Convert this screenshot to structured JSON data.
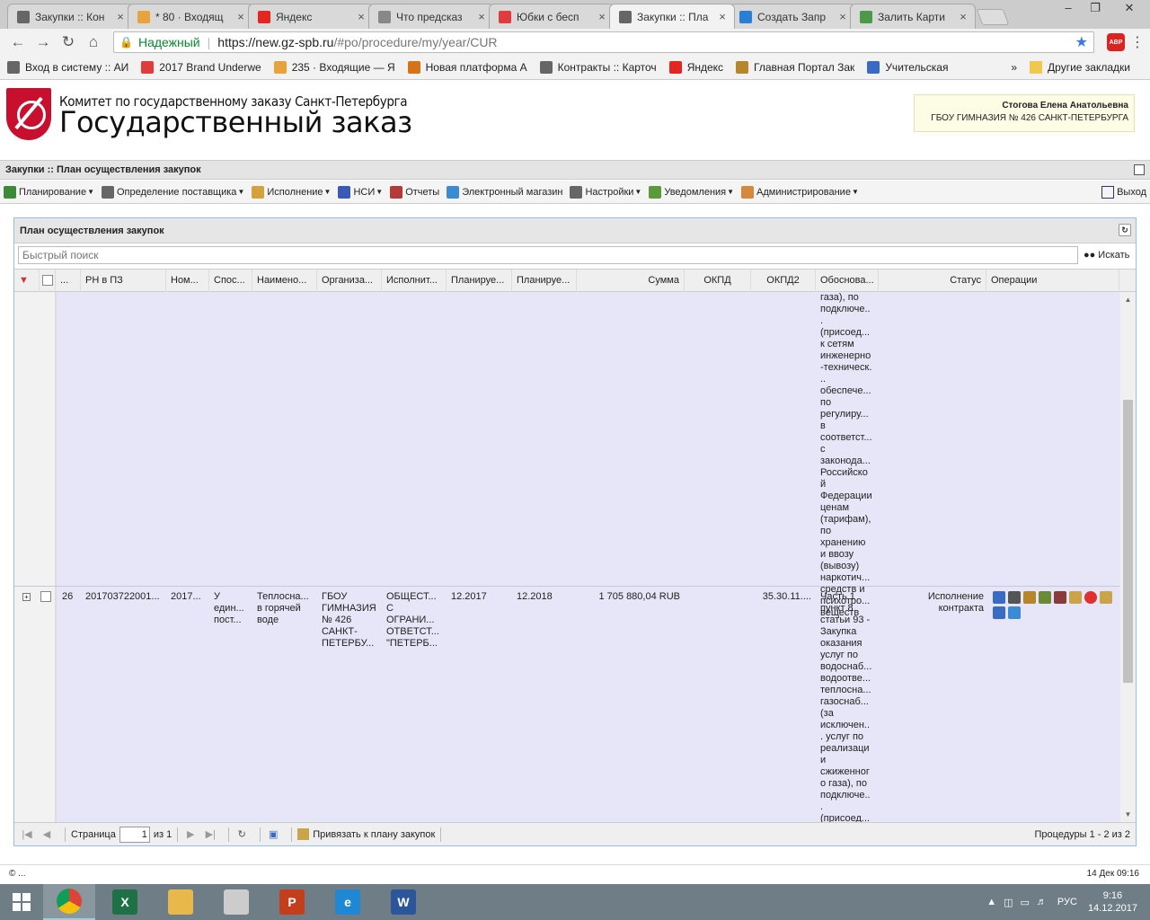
{
  "browser": {
    "tabs": [
      {
        "label": "Закупки :: Кон",
        "icon": "hammer-icon",
        "color": "#666666",
        "active": false
      },
      {
        "label": "* 80 · Входящ",
        "icon": "mail-icon",
        "color": "#e8a33d",
        "active": false
      },
      {
        "label": "Яндекс",
        "icon": "yandex-icon",
        "color": "#e52620",
        "active": false
      },
      {
        "label": "Что предсказ",
        "icon": "page-icon",
        "color": "#888888",
        "active": false
      },
      {
        "label": "Юбки с бесп",
        "icon": "pocket-icon",
        "color": "#e03c3c",
        "active": false
      },
      {
        "label": "Закупки :: Пла",
        "icon": "hammer-icon",
        "color": "#666666",
        "active": true
      },
      {
        "label": "Создать Запр",
        "icon": "globe-icon",
        "color": "#2a7fd4",
        "active": false
      },
      {
        "label": "Залить Карти",
        "icon": "image-icon",
        "color": "#4a9a4a",
        "active": false
      }
    ],
    "url_secure_label": "Надежный",
    "url_host": "https://new.gz-spb.ru",
    "url_path": "/#po/procedure/my/year/CUR",
    "abp_label": "ABP",
    "bookmarks": [
      {
        "label": "Вход в систему :: АИ",
        "icon": "hammer-icon",
        "color": "#666666"
      },
      {
        "label": "2017 Brand Underwe",
        "icon": "pocket-icon",
        "color": "#e03c3c"
      },
      {
        "label": "235 · Входящие — Я",
        "icon": "mail-icon",
        "color": "#e8a33d"
      },
      {
        "label": "Новая платформа А",
        "icon": "m-icon",
        "color": "#d4731a"
      },
      {
        "label": "Контракты :: Карточ",
        "icon": "hammer-icon",
        "color": "#666666"
      },
      {
        "label": "Яндекс",
        "icon": "yandex-icon",
        "color": "#e52620"
      },
      {
        "label": "Главная Портал Зак",
        "icon": "eagle-icon",
        "color": "#b8862a"
      },
      {
        "label": "Учительская",
        "icon": "square-icon",
        "color": "#3a6bc4"
      }
    ],
    "bookmarks_more": "»",
    "other_bookmarks": "Другие закладки"
  },
  "site": {
    "subtitle": "Комитет по государственному заказу Санкт-Петербурга",
    "title": "Государственный заказ",
    "user_name": "Стогова Елена Анатольевна",
    "user_org": "ГБОУ ГИМНАЗИЯ № 426 САНКТ-ПЕТЕРБУРГА"
  },
  "app": {
    "panel_title": "Закупки :: План осуществления закупок",
    "menu": [
      {
        "label": "Планирование",
        "icon": "planning-icon",
        "color": "#3a8a3a",
        "dropdown": true
      },
      {
        "label": "Определение поставщика",
        "icon": "gears-icon",
        "color": "#666666",
        "dropdown": true
      },
      {
        "label": "Исполнение",
        "icon": "folder-icon",
        "color": "#d4a23a",
        "dropdown": true
      },
      {
        "label": "НСИ",
        "icon": "book-icon",
        "color": "#3a5ab4",
        "dropdown": true
      },
      {
        "label": "Отчеты",
        "icon": "report-icon",
        "color": "#b43a3a",
        "dropdown": false
      },
      {
        "label": "Электронный магазин",
        "icon": "cart-icon",
        "color": "#3a8ad4",
        "dropdown": false
      },
      {
        "label": "Настройки",
        "icon": "wrench-icon",
        "color": "#666666",
        "dropdown": true
      },
      {
        "label": "Уведомления",
        "icon": "notify-icon",
        "color": "#5a9a3a",
        "dropdown": true
      },
      {
        "label": "Администрирование",
        "icon": "user-icon",
        "color": "#d48a3a",
        "dropdown": true
      }
    ],
    "exit_label": "Выход"
  },
  "grid": {
    "title": "План осуществления закупок",
    "search_placeholder": "Быстрый поиск",
    "search_button": "Искать",
    "columns": [
      "...",
      "РН в ПЗ",
      "Ном...",
      "Спос...",
      "Наимено...",
      "Организа...",
      "Исполнит...",
      "Планируе...",
      "Планируе...",
      "Сумма",
      "ОКПД",
      "ОКПД2",
      "Обоснова...",
      "Статус",
      "Операции"
    ],
    "row_prev_justification": "газа), по подключе... (присоед... к сетям инженерно-техническ... обеспече... по регулиру... в соответст... с законода... Российской Федерации ценам (тарифам), по хранению и ввозу (вывозу) наркотич... средств и психотро... веществ",
    "row": {
      "num": "26",
      "rn": "201703722001...",
      "nom": "2017...",
      "method": "У един... пост...",
      "name": "Теплосна... в горячей воде",
      "org": "ГБОУ ГИМНАЗИЯ № 426 САНКТ-ПЕТЕРБУ...",
      "executor": "ОБЩЕСТ... С ОГРАНИ... ОТВЕТСТ... \"ПЕТЕРБ...",
      "plan1": "12.2017",
      "plan2": "12.2018",
      "sum": "1 705 880,04 RUB",
      "okpd": "",
      "okpd2": "35.30.11....",
      "justification": "Часть 1 пункт 8 статьи 93 - Закупка оказания услуг по водоснаб... водоотве... теплосна... газоснаб... (за исключен... услуг по реализации сжиженного газа), по подключе... (присоед... к сетям инженерно-",
      "status": "Исполнение контракта",
      "ops": [
        "chart-icon",
        "gears-icon",
        "eagle-icon",
        "archive-icon",
        "doc-icon",
        "edit-icon",
        "stop-icon",
        "list-icon",
        "books-icon",
        "info-icon"
      ]
    },
    "pager": {
      "page_label": "Страница",
      "page_value": "1",
      "of_label": "из 1",
      "bind_label": "Привязать к плану закупок",
      "info": "Процедуры 1 - 2 из 2"
    }
  },
  "statusbar": {
    "left": "© ...",
    "right": "14 Дек 09:16"
  },
  "taskbar": {
    "apps": [
      {
        "name": "chrome",
        "letter": "",
        "color": "#e8c33a",
        "active": true
      },
      {
        "name": "excel",
        "letter": "X",
        "color": "#1e7145",
        "active": false
      },
      {
        "name": "explorer",
        "letter": "",
        "color": "#e8b84a",
        "active": false
      },
      {
        "name": "printer",
        "letter": "",
        "color": "#cccccc",
        "active": false
      },
      {
        "name": "powerpoint",
        "letter": "P",
        "color": "#c43e1c",
        "active": false
      },
      {
        "name": "ie",
        "letter": "e",
        "color": "#1e88d4",
        "active": false
      },
      {
        "name": "word",
        "letter": "W",
        "color": "#2b579a",
        "active": false
      }
    ],
    "lang": "РУС",
    "time": "9:16",
    "date": "14.12.2017"
  }
}
